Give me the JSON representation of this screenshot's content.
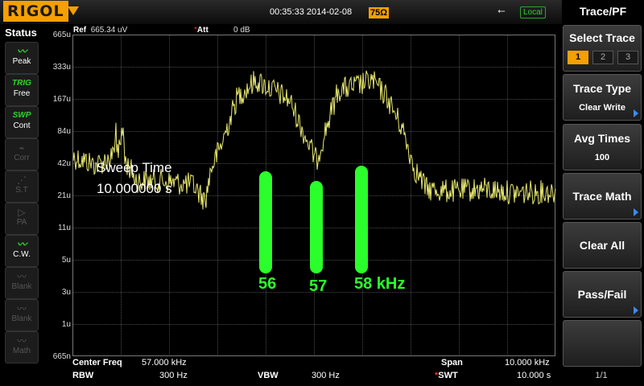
{
  "header": {
    "logo": "RIGOL",
    "datetime": "00:35:33 2014-02-08",
    "impedance": "75Ω",
    "mode": "Local",
    "colors": {
      "accent": "#f4a000",
      "trace": "#e8e870",
      "marker": "#2bff2b",
      "local": "#2bd42b"
    }
  },
  "status": {
    "title": "Status",
    "items": [
      {
        "icon": "peak-icon",
        "glyph": "〰",
        "label": "Peak",
        "enabled": true
      },
      {
        "icon": "trig-icon",
        "glyph": "TRIG",
        "label": "Free",
        "enabled": true
      },
      {
        "icon": "swp-icon",
        "glyph": "SWP",
        "label": "Cont",
        "enabled": true
      },
      {
        "icon": "corr-icon",
        "glyph": "⌁",
        "label": "Corr",
        "enabled": false
      },
      {
        "icon": "st-icon",
        "glyph": "⋰",
        "label": "S.T",
        "enabled": false
      },
      {
        "icon": "pa-icon",
        "glyph": "▷",
        "label": "PA",
        "enabled": false
      },
      {
        "icon": "cw-icon",
        "glyph": "〰",
        "label": "C.W.",
        "enabled": true
      },
      {
        "icon": "blank-icon",
        "glyph": "〰",
        "label": "Blank",
        "enabled": false
      },
      {
        "icon": "blank-icon",
        "glyph": "〰",
        "label": "Blank",
        "enabled": false
      },
      {
        "icon": "math-icon",
        "glyph": "〰",
        "label": "Math",
        "enabled": false
      }
    ]
  },
  "display": {
    "ref_label": "Ref",
    "ref_value": "665.34 uV",
    "att_marker": "*",
    "att_label": "Att",
    "att_value": "0 dB",
    "y_labels": [
      "665u",
      "333u",
      "167u",
      "84u",
      "42u",
      "21u",
      "11u",
      "5u",
      "3u",
      "1u",
      "665n"
    ],
    "sweep_time_label": "Sweep Time",
    "sweep_time_value": "10.000000 s",
    "markers": [
      {
        "label": "56",
        "level": 0.53
      },
      {
        "label": "57",
        "level": 0.48
      },
      {
        "label": "58 kHz",
        "level": 0.56
      }
    ]
  },
  "footer": {
    "center_freq_label": "Center Freq",
    "center_freq_value": "57.000 kHz",
    "span_label": "Span",
    "span_value": "10.000 kHz",
    "rbw_label": "RBW",
    "rbw_value": "300 Hz",
    "vbw_label": "VBW",
    "vbw_value": "300 Hz",
    "swt_marker": "*",
    "swt_label": "SWT",
    "swt_value": "10.000 s"
  },
  "menu": {
    "title": "Trace/PF",
    "select_trace": "Select Trace",
    "traces": [
      "1",
      "2",
      "3"
    ],
    "selected_trace": "1",
    "trace_type": "Trace Type",
    "trace_type_value": "Clear Write",
    "avg_times": "Avg Times",
    "avg_times_value": "100",
    "trace_math": "Trace Math",
    "clear_all": "Clear All",
    "pass_fail": "Pass/Fail",
    "page": "1/1"
  }
}
